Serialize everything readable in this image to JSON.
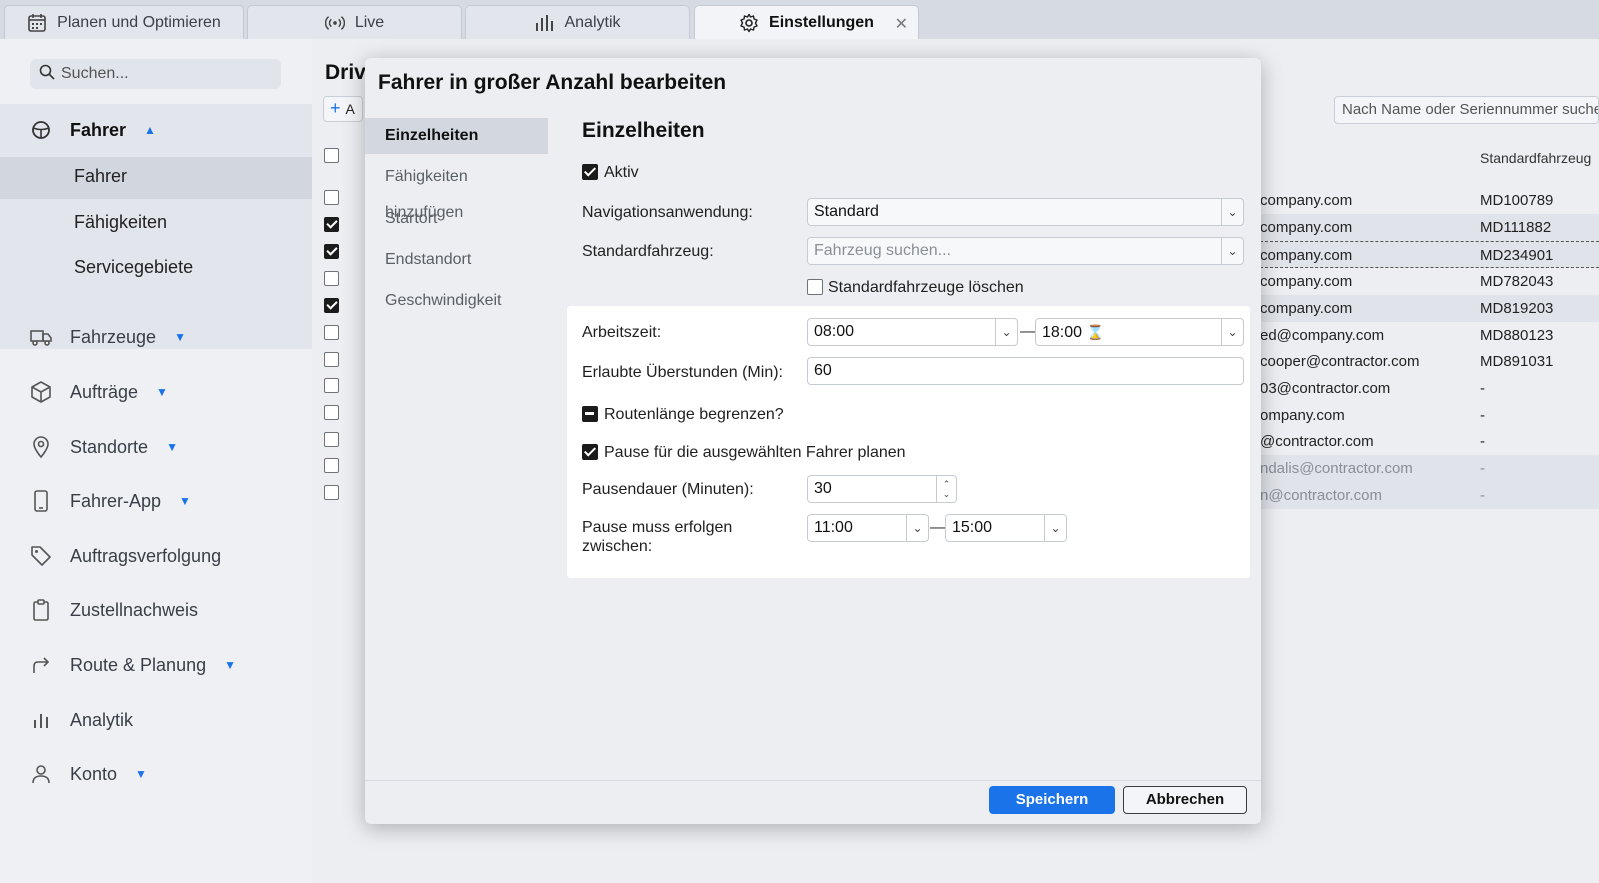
{
  "tabs": [
    {
      "label": "Planen und Optimieren",
      "icon": "calendar-icon"
    },
    {
      "label": "Live",
      "icon": "broadcast-icon"
    },
    {
      "label": "Analytik",
      "icon": "bar-chart-icon"
    },
    {
      "label": "Einstellungen",
      "icon": "gear-icon",
      "active": true,
      "close": "✕"
    }
  ],
  "sidebar": {
    "search_placeholder": "Suchen...",
    "group": {
      "label": "Fahrer",
      "items": [
        "Fahrer",
        "Fähigkeiten",
        "Servicegebiete"
      ]
    },
    "items": [
      {
        "label": "Fahrzeuge",
        "icon": "truck-icon"
      },
      {
        "label": "Aufträge",
        "icon": "box-icon"
      },
      {
        "label": "Standorte",
        "icon": "location-pin-icon"
      },
      {
        "label": "Fahrer-App",
        "icon": "phone-icon"
      },
      {
        "label": "Auftragsverfolgung",
        "icon": "tag-icon"
      },
      {
        "label": "Zustellnachweis",
        "icon": "clipboard-icon"
      },
      {
        "label": "Route & Planung",
        "icon": "route-arrow-icon"
      },
      {
        "label": "Analytik",
        "icon": "bar-chart-icon"
      },
      {
        "label": "Konto",
        "icon": "user-icon"
      }
    ]
  },
  "main": {
    "title": "Driv",
    "add_label": "A",
    "search_placeholder": "Nach Name oder Seriennummer suchen",
    "column_vehicle": "Standardfahrzeug",
    "rows": [
      {
        "email": "company.com",
        "vehicle": "MD100789"
      },
      {
        "email": "company.com",
        "vehicle": "MD111882"
      },
      {
        "email": "company.com",
        "vehicle": "MD234901"
      },
      {
        "email": "company.com",
        "vehicle": "MD782043"
      },
      {
        "email": "company.com",
        "vehicle": "MD819203"
      },
      {
        "email": "ed@company.com",
        "vehicle": "MD880123"
      },
      {
        "email": "cooper@contractor.com",
        "vehicle": "MD891031"
      },
      {
        "email": "03@contractor.com",
        "vehicle": "-"
      },
      {
        "email": "ompany.com",
        "vehicle": "-"
      },
      {
        "email": "@contractor.com",
        "vehicle": "-"
      },
      {
        "email": "ndalis@contractor.com",
        "vehicle": "-"
      },
      {
        "email": "n@contractor.com",
        "vehicle": "-"
      }
    ]
  },
  "modal": {
    "title": "Fahrer in großer Anzahl bearbeiten",
    "nav": [
      "Einzelheiten",
      "Fähigkeiten hinzufügen",
      "Startort",
      "Endstandort",
      "Geschwindigkeit"
    ],
    "section_title": "Einzelheiten",
    "active_label": "Aktiv",
    "nav_app_label": "Navigationsanwendung:",
    "nav_app_value": "Standard",
    "vehicle_label": "Standardfahrzeug:",
    "vehicle_placeholder": "Fahrzeug suchen...",
    "clear_vehicles_label": "Standardfahrzeuge löschen",
    "work_time_label": "Arbeitszeit:",
    "work_start": "08:00",
    "work_end": "18:00",
    "hourglass": "⌛",
    "overtime_label": "Erlaubte Überstunden (Min):",
    "overtime_value": "60",
    "route_limit_label": "Routenlänge begrenzen?",
    "break_label": "Pause für die ausgewählten Fahrer planen",
    "break_duration_label": "Pausendauer (Minuten):",
    "break_duration_value": "30",
    "break_window_label_1": "Pause muss erfolgen",
    "break_window_label_2": "zwischen:",
    "break_start": "11:00",
    "break_end": "15:00",
    "dash": "—",
    "save_label": "Speichern",
    "cancel_label": "Abbrechen"
  }
}
